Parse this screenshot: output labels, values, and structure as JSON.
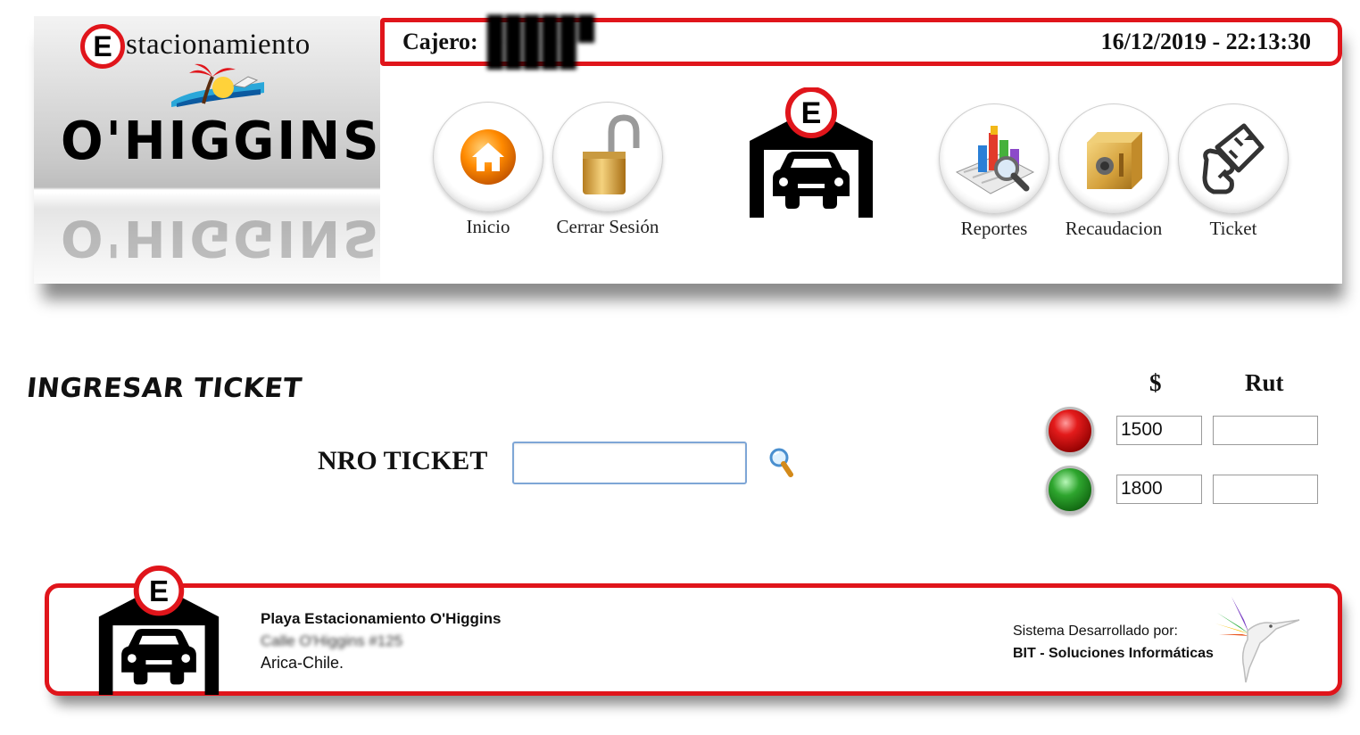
{
  "header": {
    "logo": {
      "badge_letter": "E",
      "title_rest": "stacionamiento",
      "name": "O'HIGGINS"
    },
    "cashier_label": "Cajero:",
    "cashier_name": "██████ █████",
    "datetime": "16/12/2019 - 22:13:30",
    "center_badge_letter": "E",
    "nav": [
      {
        "label": "Inicio",
        "icon": "home-icon"
      },
      {
        "label": "Cerrar Sesión",
        "icon": "padlock-icon"
      },
      {
        "label": "Reportes",
        "icon": "reports-chart-icon"
      },
      {
        "label": "Recaudacion",
        "icon": "safe-icon"
      },
      {
        "label": "Ticket",
        "icon": "ticket-hand-icon"
      }
    ]
  },
  "main": {
    "heading": "INGRESAR TICKET",
    "ticket_label": "NRO TICKET",
    "ticket_value": "",
    "price_column": "$",
    "rut_column": "Rut",
    "rates": [
      {
        "indicator": "red",
        "price": "1500",
        "rut": ""
      },
      {
        "indicator": "green",
        "price": "1800",
        "rut": ""
      }
    ]
  },
  "footer": {
    "badge_letter": "E",
    "company": "Playa Estacionamiento O'Higgins",
    "address": "Calle O'Higgins #125",
    "city": "Arica-Chile.",
    "credit_line": "Sistema Desarrollado por:",
    "credit_company": "BIT - Soluciones Informáticas"
  },
  "colors": {
    "accent_red": "#e0151b",
    "input_border": "#7ea6d6"
  }
}
